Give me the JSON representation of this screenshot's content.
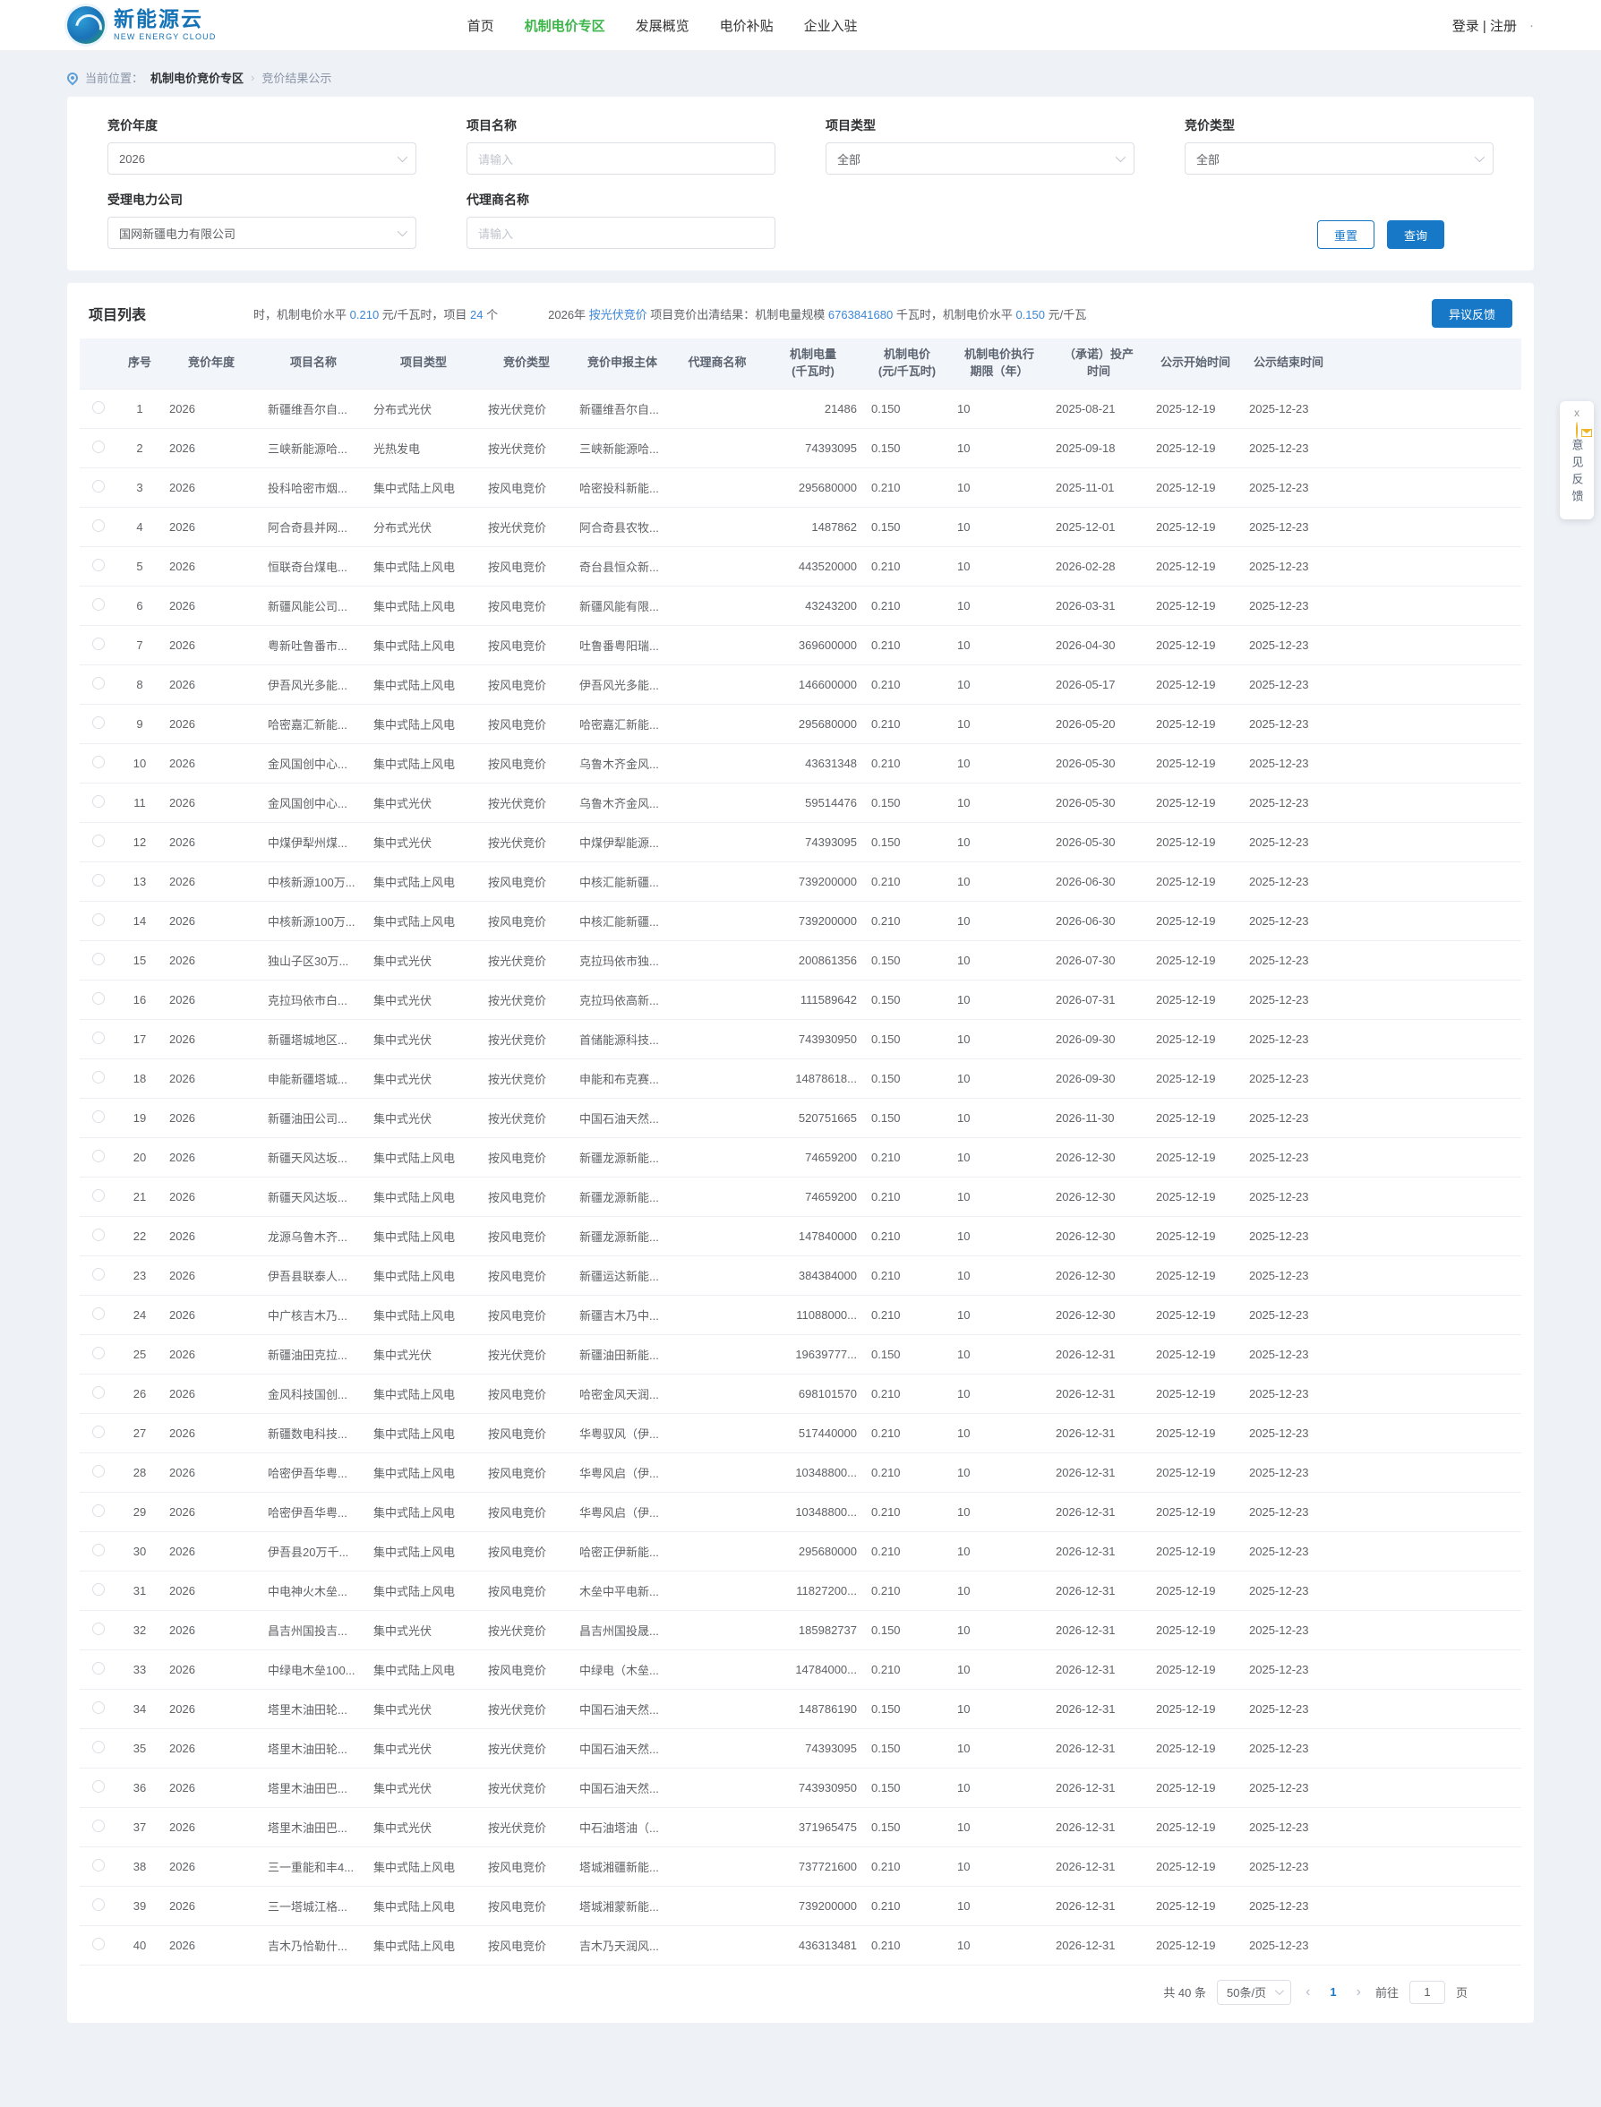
{
  "colors": {
    "accent_blue": "#1778c8",
    "link_blue": "#3d87d8",
    "nav_green": "#3db54a",
    "warning_yellow": "#f0b429",
    "page_bg": "#eef2f7"
  },
  "header": {
    "logo_title": "新能源云",
    "logo_subtitle": "NEW ENERGY CLOUD",
    "nav": [
      {
        "label": "首页",
        "active": false
      },
      {
        "label": "机制电价专区",
        "active": true
      },
      {
        "label": "发展概览",
        "active": false
      },
      {
        "label": "电价补贴",
        "active": false
      },
      {
        "label": "企业入驻",
        "active": false
      }
    ],
    "auth": "登录 | 注册",
    "dot": "·"
  },
  "breadcrumb": {
    "location_label": "当前位置：",
    "section": "机制电价竞价专区",
    "separator": "›",
    "current": "竞价结果公示"
  },
  "filters": {
    "bid_year": {
      "label": "竞价年度",
      "value": "2026"
    },
    "project_name": {
      "label": "项目名称",
      "placeholder": "请输入"
    },
    "project_type": {
      "label": "项目类型",
      "value": "全部"
    },
    "bid_type": {
      "label": "竞价类型",
      "value": "全部"
    },
    "power_company": {
      "label": "受理电力公司",
      "value": "国网新疆电力有限公司"
    },
    "agent_name": {
      "label": "代理商名称",
      "placeholder": "请输入"
    },
    "reset_label": "重置",
    "search_label": "查询"
  },
  "list": {
    "title": "项目列表",
    "feedback_button": "异议反馈",
    "ticker": {
      "seg1_pre": "时，机制电价水平 ",
      "seg1_num": "0.210",
      "seg1_mid": " 元/千瓦时，项目 ",
      "seg1_count": "24",
      "seg1_post": " 个",
      "seg2_pre": "2026年 ",
      "seg2_link": "按光伏竞价",
      "seg2_mid": " 项目竞价出清结果：机制电量规模 ",
      "seg2_num": "6763841680",
      "seg2_mid2": " 千瓦时，机制电价水平 ",
      "seg2_num2": "0.150",
      "seg2_post": " 元/千瓦"
    }
  },
  "table": {
    "headers": [
      "序号",
      "竞价年度",
      "项目名称",
      "项目类型",
      "竞价类型",
      "竞价申报主体",
      "代理商名称",
      "机制电量\n(千瓦时)",
      "机制电价\n(元/千瓦时)",
      "机制电价执行\n期限（年）",
      "（承诺）投产\n时间",
      "公示开始时间",
      "公示结束时间"
    ],
    "col_keys": [
      "seq",
      "bid-year",
      "project-name",
      "project-type",
      "bid-type",
      "applicant",
      "agent-name",
      "mechanism-energy",
      "mechanism-price",
      "price-term",
      "production-date",
      "publicity-start",
      "publicity-end"
    ],
    "rows": [
      [
        "1",
        "2026",
        "新疆维吾尔自...",
        "分布式光伏",
        "按光伏竞价",
        "新疆维吾尔自...",
        "",
        "21486",
        "0.150",
        "10",
        "2025-08-21",
        "2025-12-19",
        "2025-12-23"
      ],
      [
        "2",
        "2026",
        "三峡新能源哈...",
        "光热发电",
        "按光伏竞价",
        "三峡新能源哈...",
        "",
        "74393095",
        "0.150",
        "10",
        "2025-09-18",
        "2025-12-19",
        "2025-12-23"
      ],
      [
        "3",
        "2026",
        "投科哈密市烟...",
        "集中式陆上风电",
        "按风电竞价",
        "哈密投科新能...",
        "",
        "295680000",
        "0.210",
        "10",
        "2025-11-01",
        "2025-12-19",
        "2025-12-23"
      ],
      [
        "4",
        "2026",
        "阿合奇县并网...",
        "分布式光伏",
        "按光伏竞价",
        "阿合奇县农牧...",
        "",
        "1487862",
        "0.150",
        "10",
        "2025-12-01",
        "2025-12-19",
        "2025-12-23"
      ],
      [
        "5",
        "2026",
        "恒联奇台煤电...",
        "集中式陆上风电",
        "按风电竞价",
        "奇台县恒众新...",
        "",
        "443520000",
        "0.210",
        "10",
        "2026-02-28",
        "2025-12-19",
        "2025-12-23"
      ],
      [
        "6",
        "2026",
        "新疆风能公司...",
        "集中式陆上风电",
        "按风电竞价",
        "新疆风能有限...",
        "",
        "43243200",
        "0.210",
        "10",
        "2026-03-31",
        "2025-12-19",
        "2025-12-23"
      ],
      [
        "7",
        "2026",
        "粤新吐鲁番市...",
        "集中式陆上风电",
        "按风电竞价",
        "吐鲁番粤阳瑞...",
        "",
        "369600000",
        "0.210",
        "10",
        "2026-04-30",
        "2025-12-19",
        "2025-12-23"
      ],
      [
        "8",
        "2026",
        "伊吾风光多能...",
        "集中式陆上风电",
        "按风电竞价",
        "伊吾风光多能...",
        "",
        "146600000",
        "0.210",
        "10",
        "2026-05-17",
        "2025-12-19",
        "2025-12-23"
      ],
      [
        "9",
        "2026",
        "哈密嘉汇新能...",
        "集中式陆上风电",
        "按风电竞价",
        "哈密嘉汇新能...",
        "",
        "295680000",
        "0.210",
        "10",
        "2026-05-20",
        "2025-12-19",
        "2025-12-23"
      ],
      [
        "10",
        "2026",
        "金风国创中心...",
        "集中式陆上风电",
        "按风电竞价",
        "乌鲁木齐金风...",
        "",
        "43631348",
        "0.210",
        "10",
        "2026-05-30",
        "2025-12-19",
        "2025-12-23"
      ],
      [
        "11",
        "2026",
        "金风国创中心...",
        "集中式光伏",
        "按光伏竞价",
        "乌鲁木齐金风...",
        "",
        "59514476",
        "0.150",
        "10",
        "2026-05-30",
        "2025-12-19",
        "2025-12-23"
      ],
      [
        "12",
        "2026",
        "中煤伊犁州煤...",
        "集中式光伏",
        "按光伏竞价",
        "中煤伊犁能源...",
        "",
        "74393095",
        "0.150",
        "10",
        "2026-05-30",
        "2025-12-19",
        "2025-12-23"
      ],
      [
        "13",
        "2026",
        "中核新源100万...",
        "集中式陆上风电",
        "按风电竞价",
        "中核汇能新疆...",
        "",
        "739200000",
        "0.210",
        "10",
        "2026-06-30",
        "2025-12-19",
        "2025-12-23"
      ],
      [
        "14",
        "2026",
        "中核新源100万...",
        "集中式陆上风电",
        "按风电竞价",
        "中核汇能新疆...",
        "",
        "739200000",
        "0.210",
        "10",
        "2026-06-30",
        "2025-12-19",
        "2025-12-23"
      ],
      [
        "15",
        "2026",
        "独山子区30万...",
        "集中式光伏",
        "按光伏竞价",
        "克拉玛依市独...",
        "",
        "200861356",
        "0.150",
        "10",
        "2026-07-30",
        "2025-12-19",
        "2025-12-23"
      ],
      [
        "16",
        "2026",
        "克拉玛依市白...",
        "集中式光伏",
        "按光伏竞价",
        "克拉玛依高新...",
        "",
        "111589642",
        "0.150",
        "10",
        "2026-07-31",
        "2025-12-19",
        "2025-12-23"
      ],
      [
        "17",
        "2026",
        "新疆塔城地区...",
        "集中式光伏",
        "按光伏竞价",
        "首储能源科技...",
        "",
        "743930950",
        "0.150",
        "10",
        "2026-09-30",
        "2025-12-19",
        "2025-12-23"
      ],
      [
        "18",
        "2026",
        "申能新疆塔城...",
        "集中式光伏",
        "按光伏竞价",
        "申能和布克赛...",
        "",
        "14878618...",
        "0.150",
        "10",
        "2026-09-30",
        "2025-12-19",
        "2025-12-23"
      ],
      [
        "19",
        "2026",
        "新疆油田公司...",
        "集中式光伏",
        "按光伏竞价",
        "中国石油天然...",
        "",
        "520751665",
        "0.150",
        "10",
        "2026-11-30",
        "2025-12-19",
        "2025-12-23"
      ],
      [
        "20",
        "2026",
        "新疆天风达坂...",
        "集中式陆上风电",
        "按风电竞价",
        "新疆龙源新能...",
        "",
        "74659200",
        "0.210",
        "10",
        "2026-12-30",
        "2025-12-19",
        "2025-12-23"
      ],
      [
        "21",
        "2026",
        "新疆天风达坂...",
        "集中式陆上风电",
        "按风电竞价",
        "新疆龙源新能...",
        "",
        "74659200",
        "0.210",
        "10",
        "2026-12-30",
        "2025-12-19",
        "2025-12-23"
      ],
      [
        "22",
        "2026",
        "龙源乌鲁木齐...",
        "集中式陆上风电",
        "按风电竞价",
        "新疆龙源新能...",
        "",
        "147840000",
        "0.210",
        "10",
        "2026-12-30",
        "2025-12-19",
        "2025-12-23"
      ],
      [
        "23",
        "2026",
        "伊吾县联泰人...",
        "集中式陆上风电",
        "按风电竞价",
        "新疆运达新能...",
        "",
        "384384000",
        "0.210",
        "10",
        "2026-12-30",
        "2025-12-19",
        "2025-12-23"
      ],
      [
        "24",
        "2026",
        "中广核吉木乃...",
        "集中式陆上风电",
        "按风电竞价",
        "新疆吉木乃中...",
        "",
        "11088000...",
        "0.210",
        "10",
        "2026-12-30",
        "2025-12-19",
        "2025-12-23"
      ],
      [
        "25",
        "2026",
        "新疆油田克拉...",
        "集中式光伏",
        "按光伏竞价",
        "新疆油田新能...",
        "",
        "19639777...",
        "0.150",
        "10",
        "2026-12-31",
        "2025-12-19",
        "2025-12-23"
      ],
      [
        "26",
        "2026",
        "金风科技国创...",
        "集中式陆上风电",
        "按风电竞价",
        "哈密金风天润...",
        "",
        "698101570",
        "0.210",
        "10",
        "2026-12-31",
        "2025-12-19",
        "2025-12-23"
      ],
      [
        "27",
        "2026",
        "新疆数电科技...",
        "集中式陆上风电",
        "按风电竞价",
        "华粤驭风（伊...",
        "",
        "517440000",
        "0.210",
        "10",
        "2026-12-31",
        "2025-12-19",
        "2025-12-23"
      ],
      [
        "28",
        "2026",
        "哈密伊吾华粤...",
        "集中式陆上风电",
        "按风电竞价",
        "华粤风启（伊...",
        "",
        "10348800...",
        "0.210",
        "10",
        "2026-12-31",
        "2025-12-19",
        "2025-12-23"
      ],
      [
        "29",
        "2026",
        "哈密伊吾华粤...",
        "集中式陆上风电",
        "按风电竞价",
        "华粤风启（伊...",
        "",
        "10348800...",
        "0.210",
        "10",
        "2026-12-31",
        "2025-12-19",
        "2025-12-23"
      ],
      [
        "30",
        "2026",
        "伊吾县20万千...",
        "集中式陆上风电",
        "按风电竞价",
        "哈密正伊新能...",
        "",
        "295680000",
        "0.210",
        "10",
        "2026-12-31",
        "2025-12-19",
        "2025-12-23"
      ],
      [
        "31",
        "2026",
        "中电神火木垒...",
        "集中式陆上风电",
        "按风电竞价",
        "木垒中平电新...",
        "",
        "11827200...",
        "0.210",
        "10",
        "2026-12-31",
        "2025-12-19",
        "2025-12-23"
      ],
      [
        "32",
        "2026",
        "昌吉州国投吉...",
        "集中式光伏",
        "按光伏竞价",
        "昌吉州国投晟...",
        "",
        "185982737",
        "0.150",
        "10",
        "2026-12-31",
        "2025-12-19",
        "2025-12-23"
      ],
      [
        "33",
        "2026",
        "中绿电木垒100...",
        "集中式陆上风电",
        "按风电竞价",
        "中绿电（木垒...",
        "",
        "14784000...",
        "0.210",
        "10",
        "2026-12-31",
        "2025-12-19",
        "2025-12-23"
      ],
      [
        "34",
        "2026",
        "塔里木油田轮...",
        "集中式光伏",
        "按光伏竞价",
        "中国石油天然...",
        "",
        "148786190",
        "0.150",
        "10",
        "2026-12-31",
        "2025-12-19",
        "2025-12-23"
      ],
      [
        "35",
        "2026",
        "塔里木油田轮...",
        "集中式光伏",
        "按光伏竞价",
        "中国石油天然...",
        "",
        "74393095",
        "0.150",
        "10",
        "2026-12-31",
        "2025-12-19",
        "2025-12-23"
      ],
      [
        "36",
        "2026",
        "塔里木油田巴...",
        "集中式光伏",
        "按光伏竞价",
        "中国石油天然...",
        "",
        "743930950",
        "0.150",
        "10",
        "2026-12-31",
        "2025-12-19",
        "2025-12-23"
      ],
      [
        "37",
        "2026",
        "塔里木油田巴...",
        "集中式光伏",
        "按光伏竞价",
        "中石油塔油（...",
        "",
        "371965475",
        "0.150",
        "10",
        "2026-12-31",
        "2025-12-19",
        "2025-12-23"
      ],
      [
        "38",
        "2026",
        "三一重能和丰4...",
        "集中式陆上风电",
        "按风电竞价",
        "塔城湘疆新能...",
        "",
        "737721600",
        "0.210",
        "10",
        "2026-12-31",
        "2025-12-19",
        "2025-12-23"
      ],
      [
        "39",
        "2026",
        "三一塔城江格...",
        "集中式陆上风电",
        "按风电竞价",
        "塔城湘蒙新能...",
        "",
        "739200000",
        "0.210",
        "10",
        "2026-12-31",
        "2025-12-19",
        "2025-12-23"
      ],
      [
        "40",
        "2026",
        "吉木乃恰勒什...",
        "集中式陆上风电",
        "按风电竞价",
        "吉木乃天润风...",
        "",
        "436313481",
        "0.210",
        "10",
        "2026-12-31",
        "2025-12-19",
        "2025-12-23"
      ]
    ]
  },
  "pagination": {
    "total": "共 40 条",
    "page_size": "50条/页",
    "prev": "‹",
    "current_page": "1",
    "next": "›",
    "goto_label": "前往",
    "goto_value": "1",
    "page_suffix": "页"
  },
  "feedback_widget": {
    "close": "x",
    "label": "意见反馈"
  }
}
